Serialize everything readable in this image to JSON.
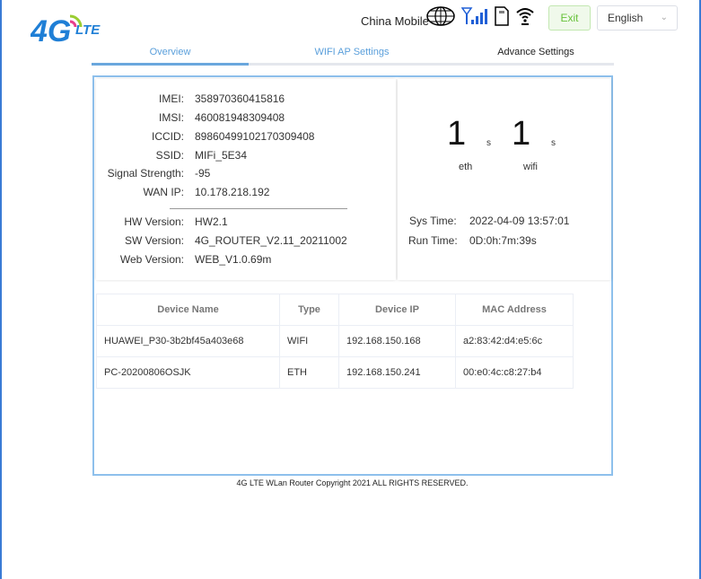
{
  "header": {
    "logo_text": "4G LTE",
    "carrier": "China Mobile",
    "icons": [
      "globe-icon",
      "signal-icon",
      "sim-card-icon",
      "wifi-icon"
    ],
    "exit_label": "Exit",
    "language": "English"
  },
  "tabs": [
    {
      "label": "Overview",
      "active": true
    },
    {
      "label": "WIFI AP Settings"
    },
    {
      "label": "Advance Settings"
    }
  ],
  "info": [
    {
      "label": "IMEI:",
      "value": "358970360415816"
    },
    {
      "label": "IMSI:",
      "value": "460081948309408"
    },
    {
      "label": "ICCID:",
      "value": "89860499102170309408"
    },
    {
      "label": "SSID:",
      "value": "MIFi_5E34"
    },
    {
      "label": "Signal Strength:",
      "value": "-95"
    },
    {
      "label": "WAN IP:",
      "value": "10.178.218.192"
    }
  ],
  "versions": [
    {
      "label": "HW Version:",
      "value": "HW2.1"
    },
    {
      "label": "SW Version:",
      "value": "4G_ROUTER_V2.11_20211002"
    },
    {
      "label": "Web Version:",
      "value": "WEB_V1.0.69m"
    }
  ],
  "clients": {
    "eth": {
      "count": "1",
      "unit": "s",
      "label": "eth"
    },
    "wifi": {
      "count": "1",
      "unit": "s",
      "label": "wifi"
    }
  },
  "times": [
    {
      "label": "Sys Time:",
      "value": "2022-04-09 13:57:01"
    },
    {
      "label": "Run Time:",
      "value": "0D:0h:7m:39s"
    }
  ],
  "devices": {
    "headers": [
      "Device Name",
      "Type",
      "Device IP",
      "MAC Address"
    ],
    "rows": [
      [
        "HUAWEI_P30-3b2bf45a403e68",
        "WIFI",
        "192.168.150.168",
        "a2:83:42:d4:e5:6c"
      ],
      [
        "PC-20200806OSJK",
        "ETH",
        "192.168.150.241",
        "00:e0:4c:c8:27:b4"
      ]
    ]
  },
  "footer": "4G LTE WLan Router Copyright 2021 ALL RIGHTS RESERVED.",
  "colors": {
    "accent": "#6aa7dd",
    "frame": "#8ec0ec",
    "exit": "#67c23a"
  }
}
